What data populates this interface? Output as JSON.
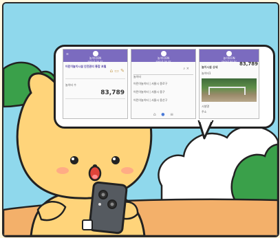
{
  "phones": [
    {
      "header_title": "놀이터ON",
      "header_sub": "seoul.go.kr",
      "row_label": "어린이놀이시설 안전관리 통합 포털",
      "count_label": "놀이터 수",
      "count_value": "83,789"
    },
    {
      "header_title": "놀이터ON",
      "header_sub": "seoul.go.kr",
      "search_value": "놀이터",
      "results": [
        "어린이놀이터 | 서울시 종로구",
        "어린이놀이터 | 서울시 중구",
        "어린이놀이터 | 서울시 용산구"
      ]
    },
    {
      "header_title": "놀이터ON",
      "header_sub": "seoul.go.kr",
      "corner_value": "83,789",
      "detail_title": "놀이시설 상세",
      "detail_sub": "놀이터1",
      "info_1": "시설명",
      "info_2": "주소"
    }
  ],
  "colors": {
    "sky": "#8fd8ec",
    "ground": "#f3b06a",
    "bush": "#3aa04a",
    "cloud": "#ffffff",
    "character": "#ffd47a",
    "phone_header": "#7b6bbf",
    "phone_body": "#555a60"
  }
}
